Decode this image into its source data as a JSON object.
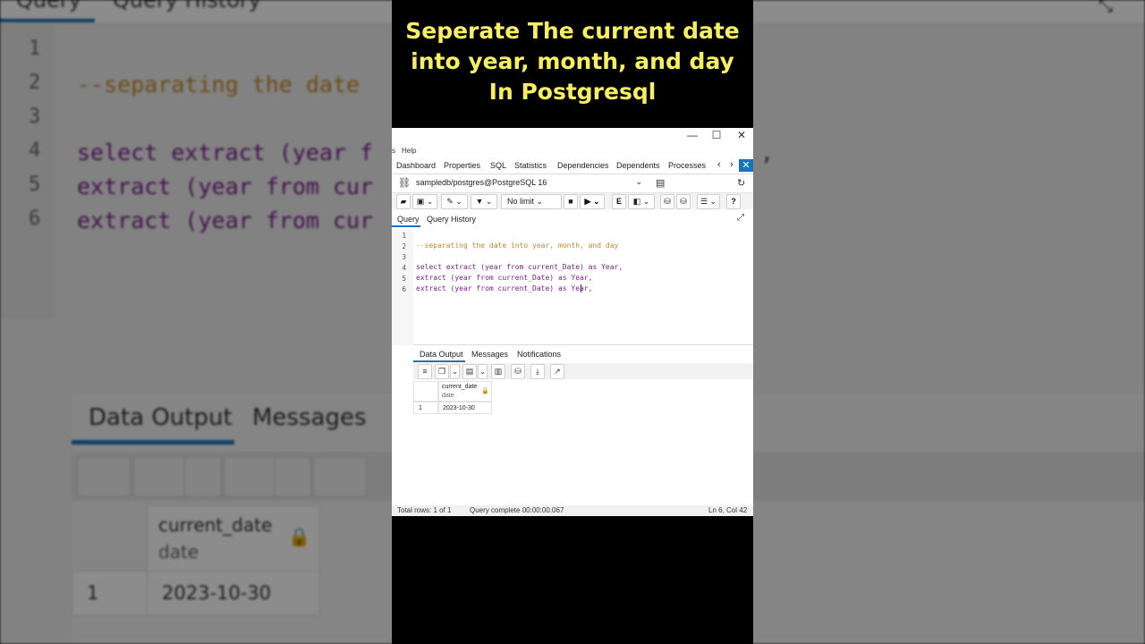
{
  "title_lines": [
    "Seperate The current date",
    "into year, month, and day",
    "In Postgresql"
  ],
  "window": {
    "minimize": "—",
    "maximize": "☐",
    "close": "✕"
  },
  "menu": {
    "items": [
      "s",
      "Help"
    ]
  },
  "tabs": [
    "Dashboard",
    "Properties",
    "SQL",
    "Statistics",
    "Dependencies",
    "Dependents",
    "Processes"
  ],
  "connection": {
    "value": "sampledb/postgres@PostgreSQL 16"
  },
  "toolbar": {
    "limit_label": "No limit"
  },
  "query_tabs": [
    "Query",
    "Query History"
  ],
  "editor": {
    "line_numbers": [
      "1",
      "2",
      "3",
      "4",
      "5",
      "6"
    ],
    "lines": [
      "",
      "--separating the date into year, month, and day",
      "",
      "select extract (year from current_Date) as Year,",
      "extract (year from current_Date) as Year,",
      "extract (year from current_Date) as Year,"
    ]
  },
  "result_tabs": [
    "Data Output",
    "Messages",
    "Notifications"
  ],
  "grid": {
    "column_name": "current_date",
    "column_type": "date",
    "row_number": "1",
    "row_value": "2023-10-30"
  },
  "status": {
    "rows": "Total rows: 1 of 1",
    "query": "Query complete 00:00:00.067",
    "cursor": "Ln 6, Col 42"
  },
  "bg": {
    "tabs": [
      "Query",
      "Query History"
    ],
    "line_numbers": [
      "1",
      "2",
      "3",
      "4",
      "5",
      "6"
    ],
    "code": [
      "--separating the date ",
      "select extract (year f",
      "extract (year from cur",
      "extract (year from cur"
    ],
    "result_tabs": [
      "Data Output",
      "Messages"
    ],
    "column_name": "current_date",
    "column_type": "date",
    "row_number": "1",
    "row_value": "2023-10-30"
  },
  "colors": {
    "title": "#f7ef62",
    "accent": "#1a73b8",
    "keyword": "#7a1f8a",
    "comment": "#c48a2a"
  }
}
